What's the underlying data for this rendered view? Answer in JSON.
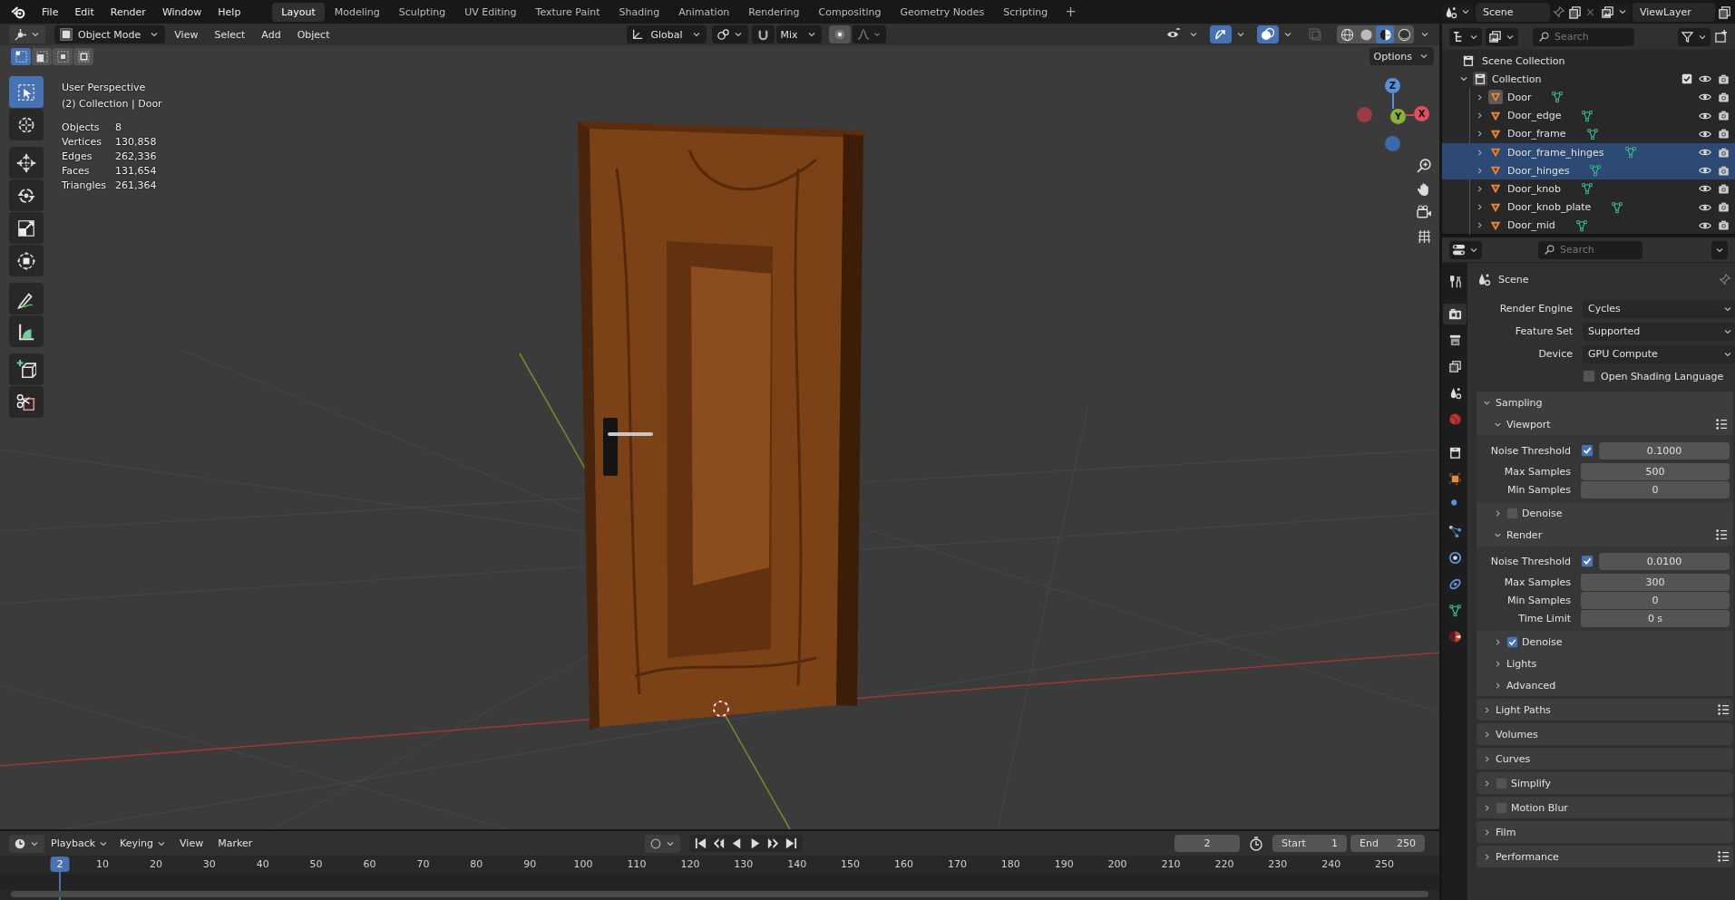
{
  "menu": [
    "File",
    "Edit",
    "Render",
    "Window",
    "Help"
  ],
  "workspaces": [
    {
      "label": "Layout",
      "selected": true
    },
    {
      "label": "Modeling",
      "selected": false
    },
    {
      "label": "Sculpting",
      "selected": false
    },
    {
      "label": "UV Editing",
      "selected": false
    },
    {
      "label": "Texture Paint",
      "selected": false
    },
    {
      "label": "Shading",
      "selected": false
    },
    {
      "label": "Animation",
      "selected": false
    },
    {
      "label": "Rendering",
      "selected": false
    },
    {
      "label": "Compositing",
      "selected": false
    },
    {
      "label": "Geometry Nodes",
      "selected": false
    },
    {
      "label": "Scripting",
      "selected": false
    }
  ],
  "add_workspace": "+",
  "scene_field": "Scene",
  "view_layer_field": "ViewLayer",
  "viewport": {
    "mode": "Object Mode",
    "menus": [
      "View",
      "Select",
      "Add",
      "Object"
    ],
    "orientation": "Global",
    "snap_target": "Mix",
    "options": "Options",
    "toggles": [
      {
        "kind": "visibility",
        "on": false
      },
      {
        "kind": "gizmo",
        "on": true
      },
      {
        "kind": "overlay",
        "on": true
      },
      {
        "kind": "xray",
        "on": false
      }
    ],
    "shading": [
      {
        "kind": "wireframe",
        "selected": false
      },
      {
        "kind": "solid",
        "selected": false
      },
      {
        "kind": "material",
        "selected": true
      },
      {
        "kind": "rendered",
        "selected": false
      }
    ],
    "select_modes": [
      {
        "selected": true
      },
      {
        "selected": false
      },
      {
        "selected": false
      },
      {
        "selected": false
      }
    ],
    "tools": [
      {
        "kind": "select",
        "selected": true
      },
      {
        "kind": "cursor",
        "selected": false
      },
      {
        "kind": "move",
        "selected": false
      },
      {
        "kind": "rotate",
        "selected": false
      },
      {
        "kind": "scale",
        "selected": false
      },
      {
        "kind": "transform",
        "selected": false
      },
      {
        "kind": "annotate",
        "selected": false
      },
      {
        "kind": "measure",
        "selected": false
      },
      {
        "kind": "add-cube",
        "selected": false
      },
      {
        "kind": "cut",
        "selected": false
      }
    ],
    "info": [
      "User Perspective",
      "(2) Collection | Door"
    ],
    "stats": [
      {
        "label": "Objects",
        "value": "8"
      },
      {
        "label": "Vertices",
        "value": "130,858"
      },
      {
        "label": "Edges",
        "value": "262,336"
      },
      {
        "label": "Faces",
        "value": "131,654"
      },
      {
        "label": "Triangles",
        "value": "261,364"
      }
    ],
    "axes": {
      "x": "X",
      "y": "Y",
      "z": "Z"
    }
  },
  "outliner": {
    "search_placeholder": "Search",
    "root": "Scene Collection",
    "collection": {
      "name": "Collection",
      "expanded": true,
      "checked": true,
      "children": [
        {
          "name": "Door",
          "selected": false,
          "active": true
        },
        {
          "name": "Door_edge",
          "selected": false,
          "active": false
        },
        {
          "name": "Door_frame",
          "selected": false,
          "active": false
        },
        {
          "name": "Door_frame_hinges",
          "selected": true,
          "active": false
        },
        {
          "name": "Door_hinges",
          "selected": true,
          "active": false
        },
        {
          "name": "Door_knob",
          "selected": false,
          "active": false
        },
        {
          "name": "Door_knob_plate",
          "selected": false,
          "active": false
        },
        {
          "name": "Door_mid",
          "selected": false,
          "active": false
        }
      ]
    }
  },
  "properties": {
    "search_placeholder": "Search",
    "context": "Scene",
    "tabs": [
      {
        "kind": "tool",
        "selected": false
      },
      {
        "kind": "render",
        "selected": true
      },
      {
        "kind": "output",
        "selected": false
      },
      {
        "kind": "view_layer",
        "selected": false
      },
      {
        "kind": "scene",
        "selected": false
      },
      {
        "kind": "world",
        "selected": false
      },
      {
        "kind": "collection",
        "selected": false
      },
      {
        "kind": "object",
        "selected": false
      },
      {
        "kind": "modifiers",
        "selected": false
      },
      {
        "kind": "particles",
        "selected": false
      },
      {
        "kind": "physics",
        "selected": false
      },
      {
        "kind": "constraints",
        "selected": false
      },
      {
        "kind": "data",
        "selected": false
      },
      {
        "kind": "material",
        "selected": false
      }
    ],
    "dropdowns": [
      {
        "label": "Render Engine",
        "value": "Cycles"
      },
      {
        "label": "Feature Set",
        "value": "Supported"
      },
      {
        "label": "Device",
        "value": "GPU Compute"
      }
    ],
    "osl": {
      "label": "Open Shading Language",
      "checked": false
    },
    "panels": [
      {
        "label": "Sampling",
        "expanded": true,
        "presets": false,
        "subpanels": [
          {
            "label": "Viewport",
            "expanded": true,
            "presets": true,
            "rows": [
              {
                "label": "Noise Threshold",
                "value": "0.1000",
                "checked": true
              },
              {
                "label": "Max Samples",
                "value": "500"
              },
              {
                "label": "Min Samples",
                "value": "0"
              }
            ]
          },
          {
            "label": "Denoise",
            "expanded": false,
            "presets": false,
            "checked": false
          },
          {
            "label": "Render",
            "expanded": true,
            "presets": true,
            "rows": [
              {
                "label": "Noise Threshold",
                "value": "0.0100",
                "checked": true
              },
              {
                "label": "Max Samples",
                "value": "300"
              },
              {
                "label": "Min Samples",
                "value": "0"
              },
              {
                "label": "Time Limit",
                "value": "0 s"
              }
            ]
          },
          {
            "label": "Denoise",
            "expanded": false,
            "presets": false,
            "checked": true
          },
          {
            "label": "Lights",
            "expanded": false,
            "presets": false
          },
          {
            "label": "Advanced",
            "expanded": false,
            "presets": false
          }
        ]
      },
      {
        "label": "Light Paths",
        "expanded": false,
        "presets": true
      },
      {
        "label": "Volumes",
        "expanded": false,
        "presets": false
      },
      {
        "label": "Curves",
        "expanded": false,
        "presets": false
      },
      {
        "label": "Simplify",
        "expanded": false,
        "presets": false,
        "checked": false
      },
      {
        "label": "Motion Blur",
        "expanded": false,
        "presets": false,
        "checked": false
      },
      {
        "label": "Film",
        "expanded": false,
        "presets": false
      },
      {
        "label": "Performance",
        "expanded": false,
        "presets": true
      }
    ]
  },
  "timeline": {
    "menus": [
      "Playback",
      "Keying",
      "View",
      "Marker"
    ],
    "current_frame": "2",
    "start_label": "Start",
    "start": "1",
    "end_label": "End",
    "end": "250",
    "playhead": "2",
    "ruler": [
      "10",
      "20",
      "30",
      "40",
      "50",
      "60",
      "70",
      "80",
      "90",
      "100",
      "110",
      "120",
      "130",
      "140",
      "150",
      "160",
      "170",
      "180",
      "190",
      "200",
      "210",
      "220",
      "230",
      "240",
      "250"
    ]
  }
}
